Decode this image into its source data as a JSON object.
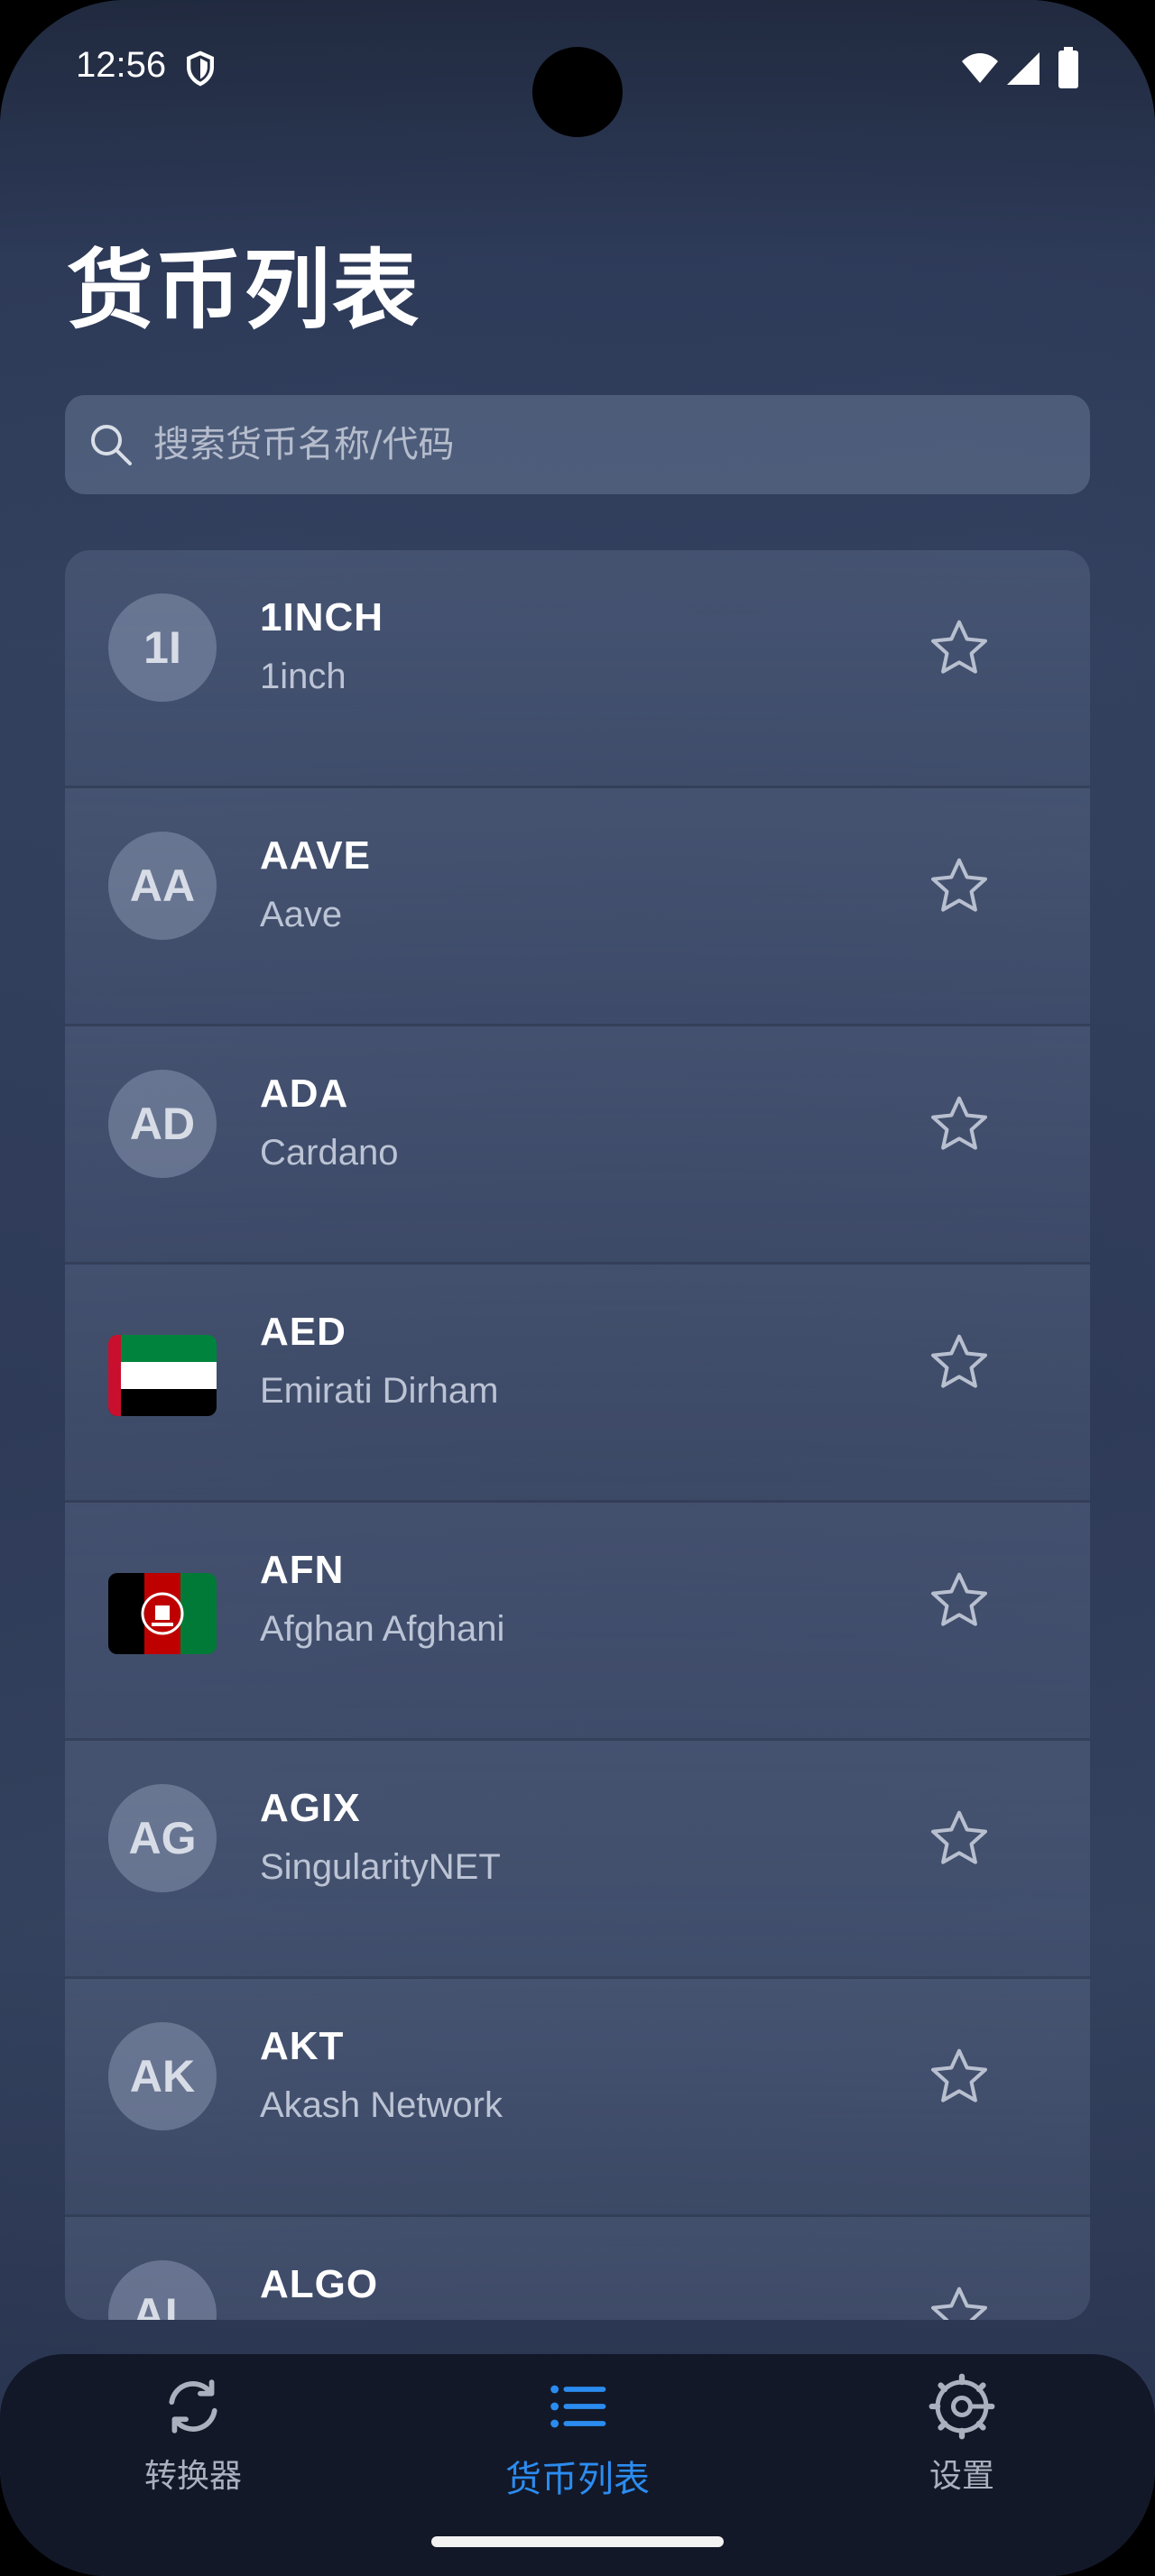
{
  "status": {
    "time": "12:56"
  },
  "title": "货币列表",
  "search": {
    "placeholder": "搜索货币名称/代码"
  },
  "currencies": [
    {
      "code": "1INCH",
      "name": "1inch",
      "initials": "1I"
    },
    {
      "code": "AAVE",
      "name": "Aave",
      "initials": "AA"
    },
    {
      "code": "ADA",
      "name": "Cardano",
      "initials": "AD"
    },
    {
      "code": "AED",
      "name": "Emirati Dirham",
      "flag": "uae-flag"
    },
    {
      "code": "AFN",
      "name": "Afghan Afghani",
      "flag": "afghanistan-flag"
    },
    {
      "code": "AGIX",
      "name": "SingularityNET",
      "initials": "AG"
    },
    {
      "code": "AKT",
      "name": "Akash Network",
      "initials": "AK"
    },
    {
      "code": "ALGO",
      "name": "",
      "initials": "AL"
    }
  ],
  "nav": {
    "items": [
      {
        "label": "转换器",
        "icon": "refresh-icon"
      },
      {
        "label": "货币列表",
        "icon": "list-icon",
        "active": true
      },
      {
        "label": "设置",
        "icon": "settings-icon"
      }
    ]
  },
  "colors": {
    "accent": "#2b8cf0",
    "nav_bg": "#121828"
  }
}
